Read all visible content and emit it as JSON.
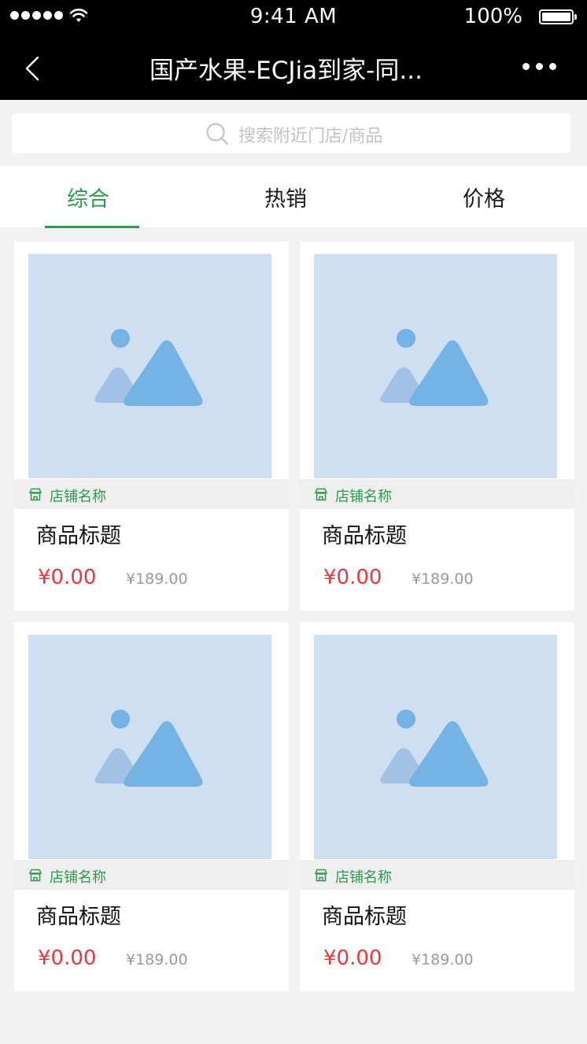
{
  "status_bar": {
    "time": "9:41 AM",
    "battery": "100%"
  },
  "nav": {
    "title": "国产水果-ECJia到家-同..."
  },
  "search": {
    "placeholder": "搜索附近门店/商品"
  },
  "tabs": [
    {
      "label": "综合",
      "active": true
    },
    {
      "label": "热销",
      "active": false
    },
    {
      "label": "价格",
      "active": false
    }
  ],
  "colors": {
    "accent": "#2e9a4f",
    "price": "#e8383d",
    "image_bg": "#cfdff2"
  },
  "products": [
    {
      "shop": "店铺名称",
      "title": "商品标题",
      "price": "¥0.00",
      "original_price": "¥189.00"
    },
    {
      "shop": "店铺名称",
      "title": "商品标题",
      "price": "¥0.00",
      "original_price": "¥189.00"
    },
    {
      "shop": "店铺名称",
      "title": "商品标题",
      "price": "¥0.00",
      "original_price": "¥189.00"
    },
    {
      "shop": "店铺名称",
      "title": "商品标题",
      "price": "¥0.00",
      "original_price": "¥189.00"
    }
  ]
}
